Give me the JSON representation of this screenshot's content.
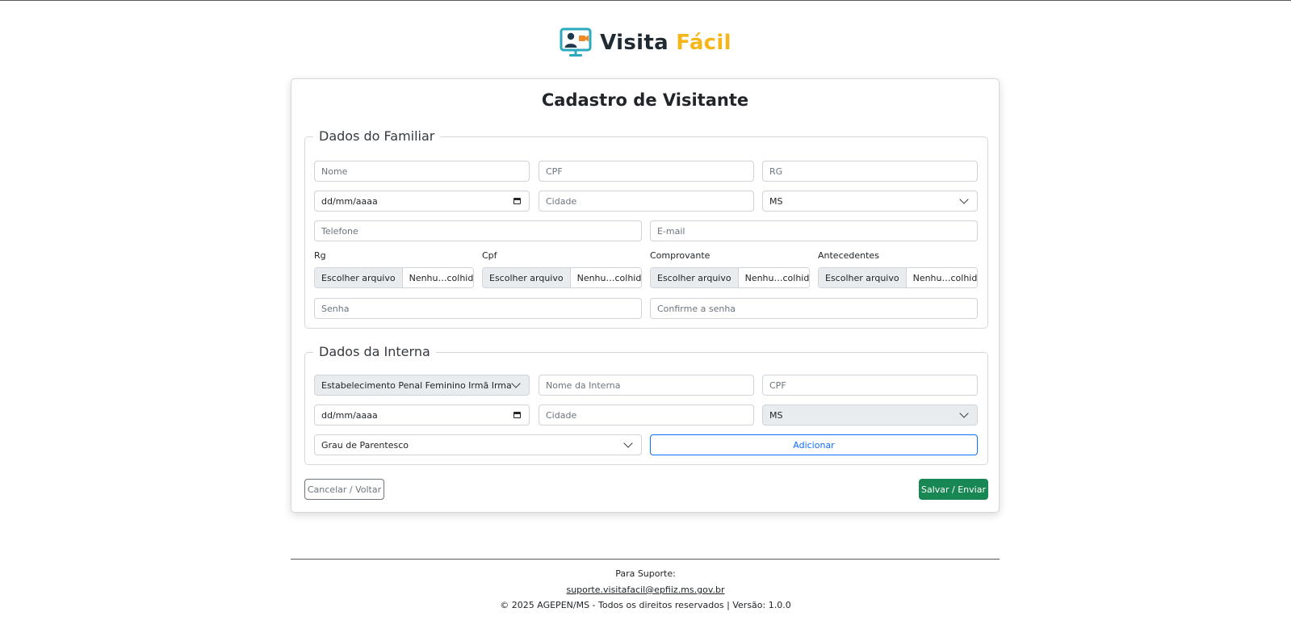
{
  "app": {
    "name_part1": "Visita",
    "name_part2": "Fácil",
    "logo_icon": "monitor-user-camera-icon",
    "colors": {
      "brand_dark": "#1f2a33",
      "brand_accent": "#f5b61a",
      "logo_teal": "#2aa9bf",
      "primary": "#0d6efd",
      "success": "#198754"
    }
  },
  "form": {
    "title": "Cadastro de Visitante",
    "familiar": {
      "legend": "Dados do Familiar",
      "nome_placeholder": "Nome",
      "cpf_placeholder": "CPF",
      "rg_placeholder": "RG",
      "nascimento_value": "dd/mm/aaaa",
      "cidade_placeholder": "Cidade",
      "uf_value": "MS",
      "telefone_placeholder": "Telefone",
      "email_placeholder": "E-mail",
      "files": [
        {
          "label": "Rg",
          "button": "Escolher arquivo",
          "status": "Nenhu…colhido"
        },
        {
          "label": "Cpf",
          "button": "Escolher arquivo",
          "status": "Nenhu…colhido"
        },
        {
          "label": "Comprovante",
          "button": "Escolher arquivo",
          "status": "Nenhu…colhido"
        },
        {
          "label": "Antecedentes",
          "button": "Escolher arquivo",
          "status": "Nenhu…colhido"
        }
      ],
      "senha_placeholder": "Senha",
      "confirma_placeholder": "Confirme a senha"
    },
    "interna": {
      "legend": "Dados da Interna",
      "estabelecimento_value": "Estabelecimento Penal Feminino Irmã Irma Zorz",
      "nome_placeholder": "Nome da Interna",
      "cpf_placeholder": "CPF",
      "nascimento_value": "dd/mm/aaaa",
      "cidade_placeholder": "Cidade",
      "uf_value": "MS",
      "parentesco_value": "Grau de Parentesco",
      "add_label": "Adicionar"
    },
    "cancel_label": "Cancelar / Voltar",
    "save_label": "Salvar / Enviar"
  },
  "footer": {
    "support_label": "Para Suporte:",
    "support_email": "suporte.visitafacil@epfiiz.ms.gov.br",
    "copyright": "© 2025 AGEPEN/MS - Todos os direitos reservados | Versão: 1.0.0"
  }
}
